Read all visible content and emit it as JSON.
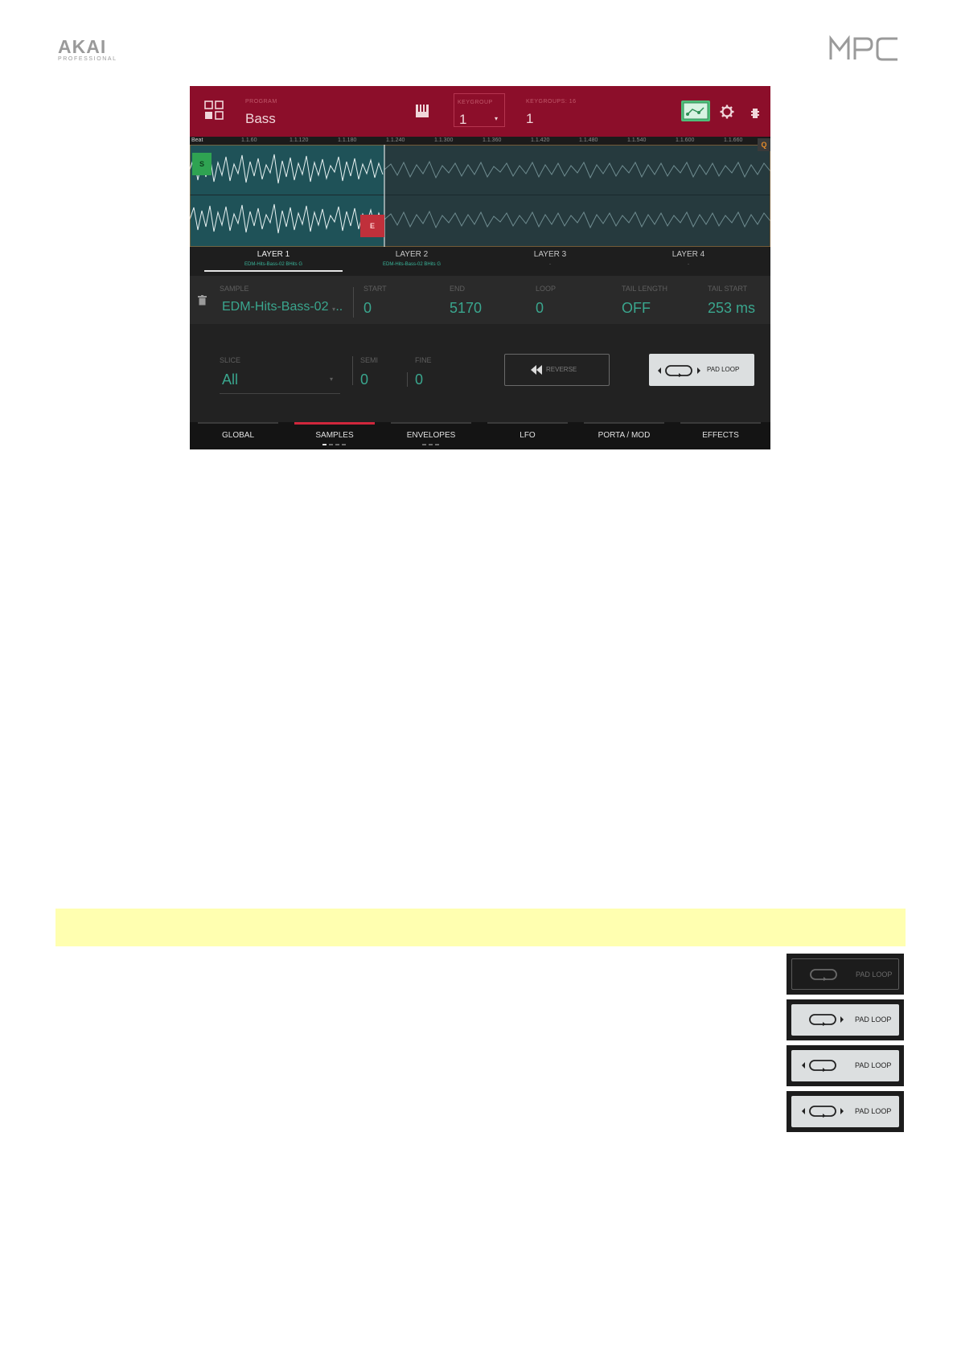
{
  "header": {
    "brand_left": "AKAI",
    "brand_left_sub": "PROFESSIONAL",
    "brand_right": "MPC"
  },
  "screen": {
    "topbar": {
      "program_label": "PROGRAM",
      "program_value": "Bass",
      "keygroup_label": "KEYGROUP",
      "keygroup_value": "1",
      "keygroups_label": "KEYGROUPS: 16",
      "keygroups_value": "1"
    },
    "waveform": {
      "ruler_mode": "Beat",
      "ruler_ticks": [
        "1.1.60",
        "1.1.120",
        "1.1.180",
        "1.1.240",
        "1.1.300",
        "1.1.360",
        "1.1.420",
        "1.1.480",
        "1.1.540",
        "1.1.600",
        "1.1.660"
      ],
      "start_marker": "S",
      "end_marker": "E",
      "q_marker": "Q"
    },
    "layers": [
      {
        "title": "LAYER 1",
        "sample": "EDM-Hits-Bass-02 BHits G"
      },
      {
        "title": "LAYER 2",
        "sample": "EDM-Hits-Bass-02 BHits G"
      },
      {
        "title": "LAYER 3",
        "sample": "-"
      },
      {
        "title": "LAYER 4",
        "sample": "-"
      }
    ],
    "params": {
      "sample_label": "SAMPLE",
      "sample_value": "EDM-Hits-Bass-02 ...",
      "start_label": "START",
      "start_value": "0",
      "end_label": "END",
      "end_value": "5170",
      "loop_label": "LOOP",
      "loop_value": "0",
      "tail_length_label": "TAIL LENGTH",
      "tail_length_value": "OFF",
      "tail_start_label": "TAIL START",
      "tail_start_value": "253 ms"
    },
    "lower": {
      "slice_label": "SLICE",
      "slice_value": "All",
      "semi_label": "SEMI",
      "semi_value": "0",
      "fine_label": "FINE",
      "fine_value": "0",
      "reverse_label": "REVERSE",
      "padloop_label": "PAD LOOP"
    },
    "tabs": [
      "GLOBAL",
      "SAMPLES",
      "ENVELOPES",
      "LFO",
      "PORTA / MOD",
      "EFFECTS"
    ],
    "active_tab": "SAMPLES"
  },
  "padloop_states": [
    "PAD LOOP",
    "PAD LOOP",
    "PAD LOOP",
    "PAD LOOP"
  ],
  "colors": {
    "topbar": "#8c0e2a",
    "accent_teal": "#3aa68e",
    "active_tab": "#d0273c",
    "note_bar": "#ffffb0"
  }
}
